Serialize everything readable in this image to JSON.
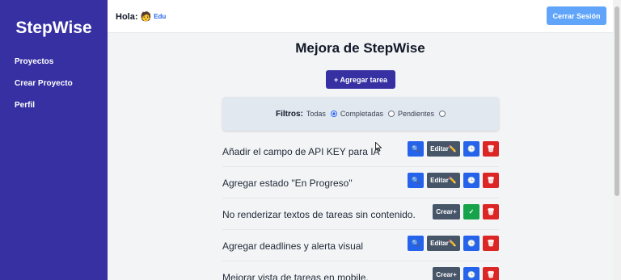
{
  "sidebar": {
    "brand": "StepWise",
    "items": [
      {
        "label": "Proyectos"
      },
      {
        "label": "Crear Proyecto"
      },
      {
        "label": "Perfil"
      }
    ]
  },
  "topbar": {
    "greeting": "Hola:",
    "emoji": "🧑",
    "username": "Edu",
    "logout_label": "Cerrar Sesión"
  },
  "main": {
    "title": "Mejora de StepWise",
    "add_task_label": "+ Agregar tarea",
    "filters": {
      "label": "Filtros:",
      "options": [
        {
          "label": "Todas",
          "selected": true
        },
        {
          "label": "Completadas",
          "selected": false
        },
        {
          "label": "Pendientes",
          "selected": false
        }
      ]
    },
    "tasks": [
      {
        "text": "Añadir el campo de API KEY para IA",
        "edit_label": "Editar✏️"
      },
      {
        "text": "Agregar estado \"En Progreso\"",
        "edit_label": "Editar✏️"
      },
      {
        "text": "No renderizar textos de tareas sin contenido.",
        "create_label": "Crear+",
        "check_glyph": "✓"
      },
      {
        "text": "Agregar deadlines y alerta visual",
        "edit_label": "Editar✏️"
      },
      {
        "text": "Mejorar vista de tareas en mobile.",
        "create_label": "Crear+"
      }
    ]
  },
  "icons": {
    "search": "🔍",
    "clock": "🕒",
    "trash": "🗑"
  },
  "colors": {
    "sidebar": "#3730a3",
    "primary": "#3730a3",
    "logout": "#60a5fa",
    "blue": "#2563eb",
    "slate": "#475569",
    "red": "#dc2626",
    "green": "#16a34a"
  }
}
